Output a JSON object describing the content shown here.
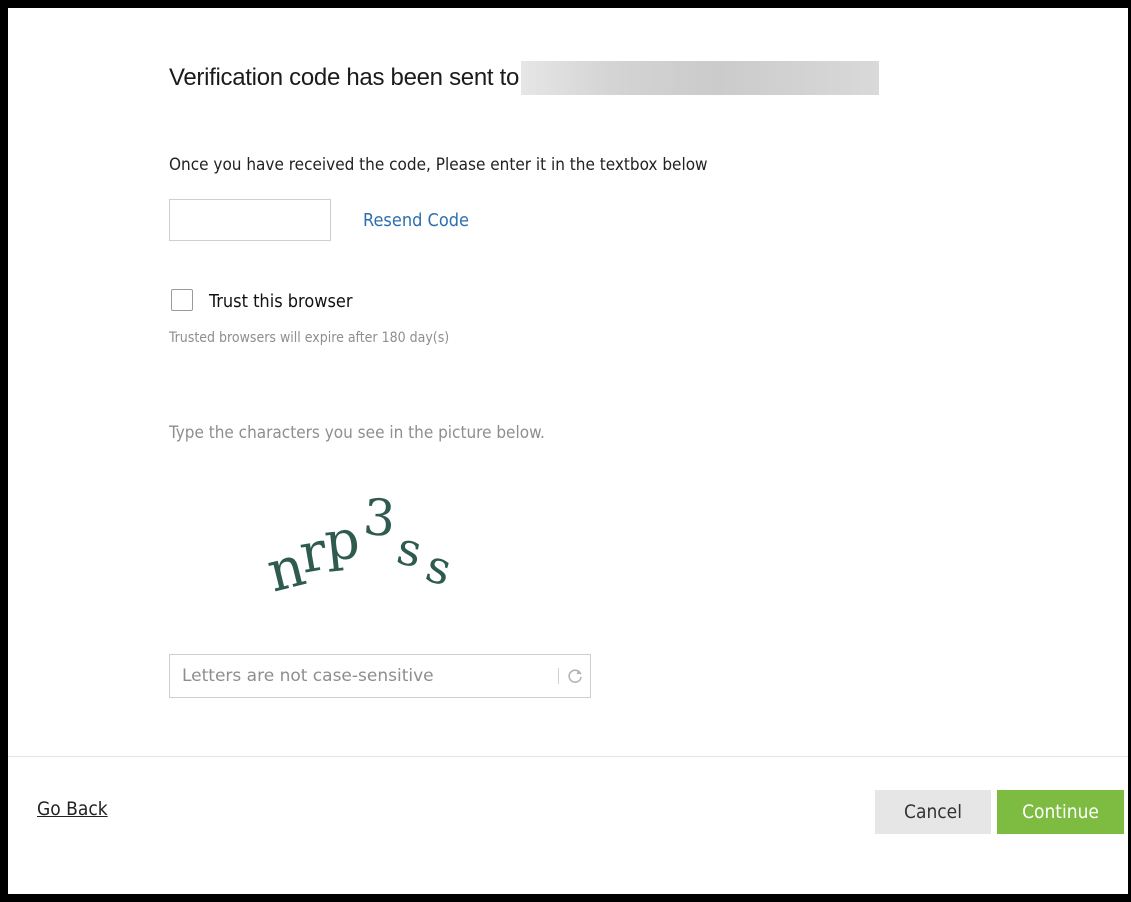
{
  "verification": {
    "heading": "Verification code has been sent to",
    "instruction": "Once you have received the code, Please enter it in the textbox below",
    "code_value": "",
    "resend_label": "Resend Code"
  },
  "trust": {
    "label": "Trust this browser",
    "checked": false,
    "note": "Trusted browsers will expire after 180 day(s)"
  },
  "captcha": {
    "prompt": "Type the characters you see in the picture below.",
    "characters": [
      "n",
      "r",
      "p",
      "3",
      "s",
      "s"
    ],
    "text_color": "#2f5a4f",
    "input_placeholder": "Letters are not case-sensitive",
    "input_value": "",
    "refresh_icon": "refresh-icon"
  },
  "footer": {
    "go_back_label": "Go Back",
    "cancel_label": "Cancel",
    "continue_label": "Continue"
  },
  "colors": {
    "link": "#2d6fad",
    "primary_button": "#7dbb41",
    "secondary_button": "#e6e6e6",
    "muted_text": "#8e8e8e"
  }
}
